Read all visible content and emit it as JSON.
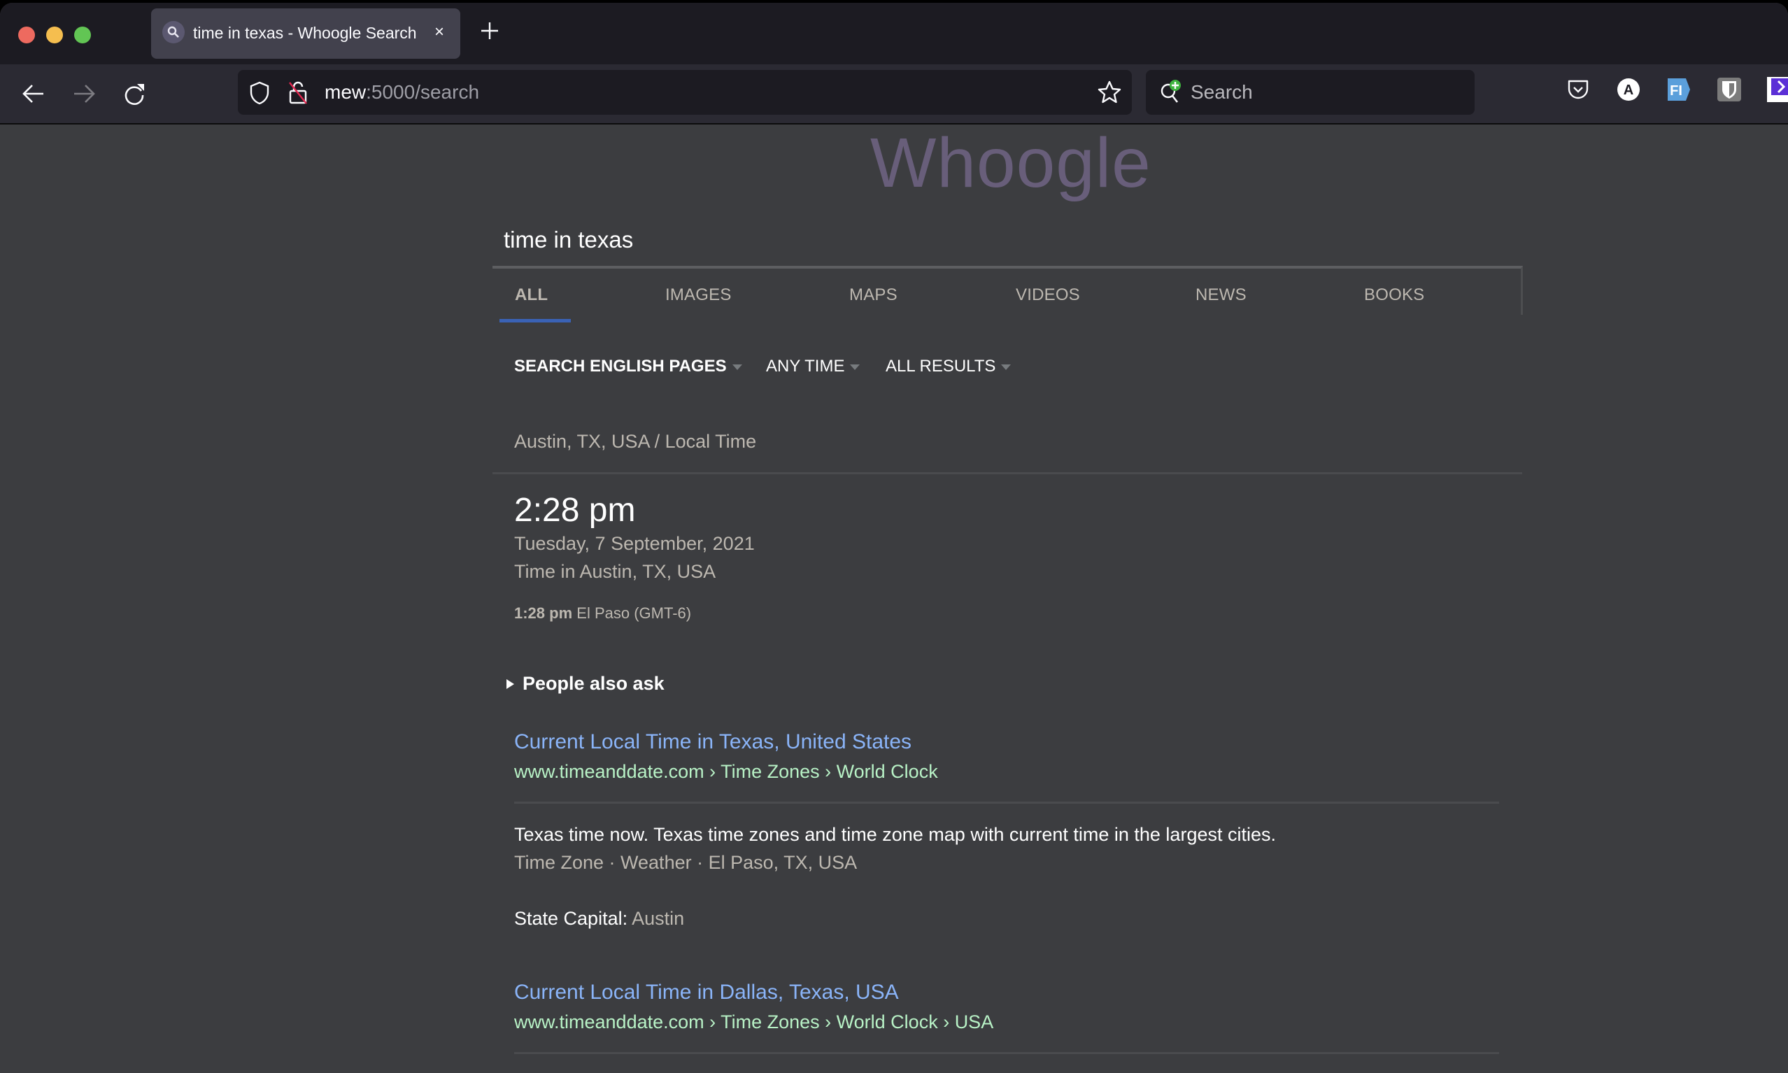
{
  "browser": {
    "tab": {
      "title": "time in texas - Whoogle Search",
      "favicon": "search-icon",
      "close": "×"
    },
    "new_tab": "+",
    "url": {
      "host": "mew",
      "rest": ":5000/search"
    },
    "search_placeholder": "Search",
    "extensions": [
      "pocket-icon",
      "a-extension-icon",
      "fi-extension-icon",
      "bitwarden-icon",
      "speedup-icon"
    ]
  },
  "page": {
    "logo": "Whoogle",
    "query": "time in texas",
    "tabs": [
      {
        "label": "ALL",
        "active": true
      },
      {
        "label": "IMAGES",
        "active": false
      },
      {
        "label": "MAPS",
        "active": false
      },
      {
        "label": "VIDEOS",
        "active": false
      },
      {
        "label": "NEWS",
        "active": false
      },
      {
        "label": "BOOKS",
        "active": false
      }
    ],
    "filters": [
      {
        "label": "SEARCH ENGLISH PAGES"
      },
      {
        "label": "ANY TIME"
      },
      {
        "label": "ALL RESULTS"
      }
    ],
    "time_card": {
      "header": "Austin, TX, USA / Local Time",
      "time": "2:28 pm",
      "date": "Tuesday, 7 September, 2021",
      "location": "Time in Austin, TX, USA",
      "other_time": "1:28 pm",
      "other_zone": "El Paso (GMT-6)"
    },
    "people_also_ask": "People also ask",
    "results": [
      {
        "title": "Current Local Time in Texas, United States",
        "url": "www.timeanddate.com › Time Zones › World Clock",
        "snippet": "Texas time now. Texas time zones and time zone map with current time in the largest cities.",
        "links": "Time Zone · Weather · El Paso, TX, USA",
        "fact_label": "State Capital:",
        "fact_value": "Austin"
      },
      {
        "title": "Current Local Time in Dallas, Texas, USA",
        "url": "www.timeanddate.com › Time Zones › World Clock › USA"
      }
    ]
  }
}
